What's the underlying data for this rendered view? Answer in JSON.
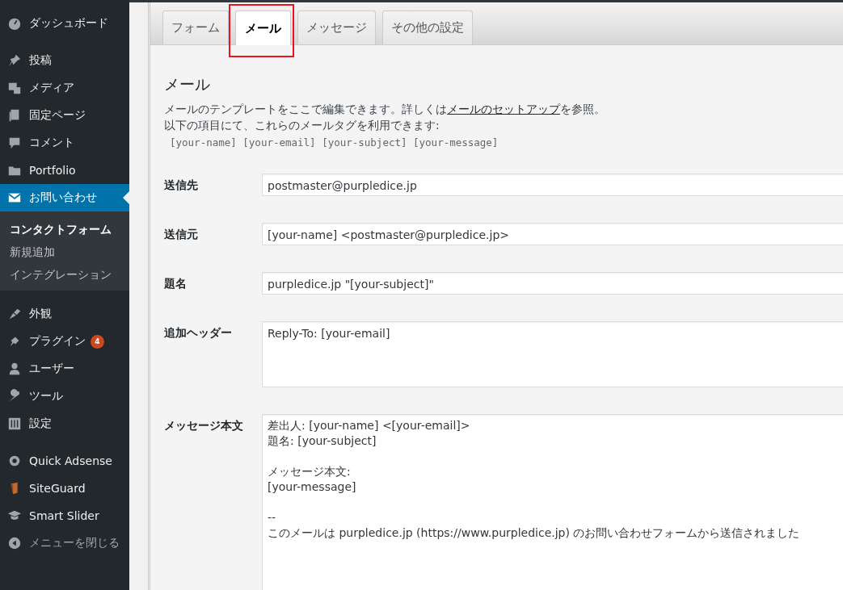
{
  "sidebar": {
    "groups": [
      [
        {
          "label": "ダッシュボード",
          "kind": "item",
          "active": false
        }
      ],
      [
        {
          "label": "投稿",
          "kind": "item",
          "active": false
        },
        {
          "label": "メディア",
          "kind": "item",
          "active": false
        },
        {
          "label": "固定ページ",
          "kind": "item",
          "active": false
        },
        {
          "label": "コメント",
          "kind": "item",
          "active": false
        },
        {
          "label": "Portfolio",
          "kind": "item",
          "active": false
        },
        {
          "label": "お問い合わせ",
          "kind": "item",
          "active": true,
          "children": [
            {
              "label": "コンタクトフォーム",
              "selected": true
            },
            {
              "label": "新規追加",
              "selected": false
            },
            {
              "label": "インテグレーション",
              "selected": false
            }
          ]
        }
      ],
      [
        {
          "label": "外観",
          "kind": "item",
          "active": false
        },
        {
          "label": "プラグイン",
          "kind": "item",
          "active": false,
          "badge": "4"
        },
        {
          "label": "ユーザー",
          "kind": "item",
          "active": false
        },
        {
          "label": "ツール",
          "kind": "item",
          "active": false
        },
        {
          "label": "設定",
          "kind": "item",
          "active": false
        }
      ],
      [
        {
          "label": "Quick Adsense",
          "kind": "item",
          "active": false
        },
        {
          "label": "SiteGuard",
          "kind": "item",
          "active": false
        },
        {
          "label": "Smart Slider",
          "kind": "item",
          "active": false
        },
        {
          "label": "メニューを閉じる",
          "kind": "collapse",
          "active": false
        }
      ]
    ]
  },
  "tabs": [
    {
      "label": "フォーム",
      "selected": false,
      "highlighted": false
    },
    {
      "label": "メール",
      "selected": true,
      "highlighted": true
    },
    {
      "label": "メッセージ",
      "selected": false,
      "highlighted": false
    },
    {
      "label": "その他の設定",
      "selected": false,
      "highlighted": false
    }
  ],
  "section": {
    "title": "メール",
    "description_before": "メールのテンプレートをここで編集できます。詳しくは",
    "description_link": "メールのセットアップ",
    "description_after": "を参照。",
    "tags_intro": "以下の項目にて、これらのメールタグを利用できます:",
    "tags": "[your-name] [your-email] [your-subject] [your-message]"
  },
  "fields": [
    {
      "label": "送信先",
      "kind": "line",
      "value": "postmaster@purpledice.jp"
    },
    {
      "label": "送信元",
      "kind": "line",
      "value": "[your-name] <postmaster@purpledice.jp>"
    },
    {
      "label": "題名",
      "kind": "line",
      "value": "purpledice.jp \"[your-subject]\""
    },
    {
      "label": "追加ヘッダー",
      "kind": "area",
      "value": "Reply-To: [your-email]"
    },
    {
      "label": "メッセージ本文",
      "kind": "body",
      "value": "差出人: [your-name] <[your-email]>\n題名: [your-subject]\n\nメッセージ本文:\n[your-message]\n\n--\nこのメールは purpledice.jp (https://www.purpledice.jp) のお問い合わせフォームから送信されました"
    }
  ]
}
